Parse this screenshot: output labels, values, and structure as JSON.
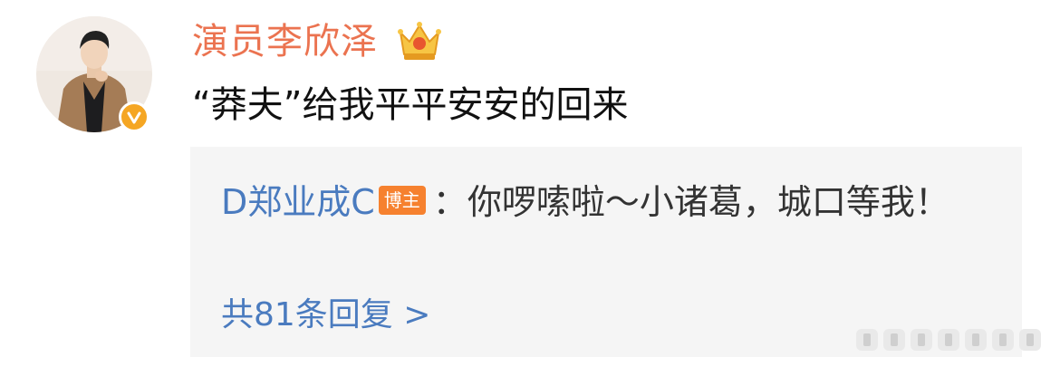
{
  "post": {
    "author": "演员李欣泽",
    "text": "“莽夫”给我平平安安的回来"
  },
  "reply": {
    "username": "D郑业成C",
    "badge": "博主",
    "separator": "：",
    "text": "你啰嗦啦～小诸葛，城口等我！",
    "more_replies": "共81条回复 >"
  },
  "colors": {
    "username": "#eb7350",
    "link": "#4a7bbf",
    "badge": "#f6812f",
    "verified": "#f5a623"
  },
  "icons": {
    "verified": "verified-icon",
    "crown": "crown-icon",
    "watermark": "weibo-watermark"
  }
}
